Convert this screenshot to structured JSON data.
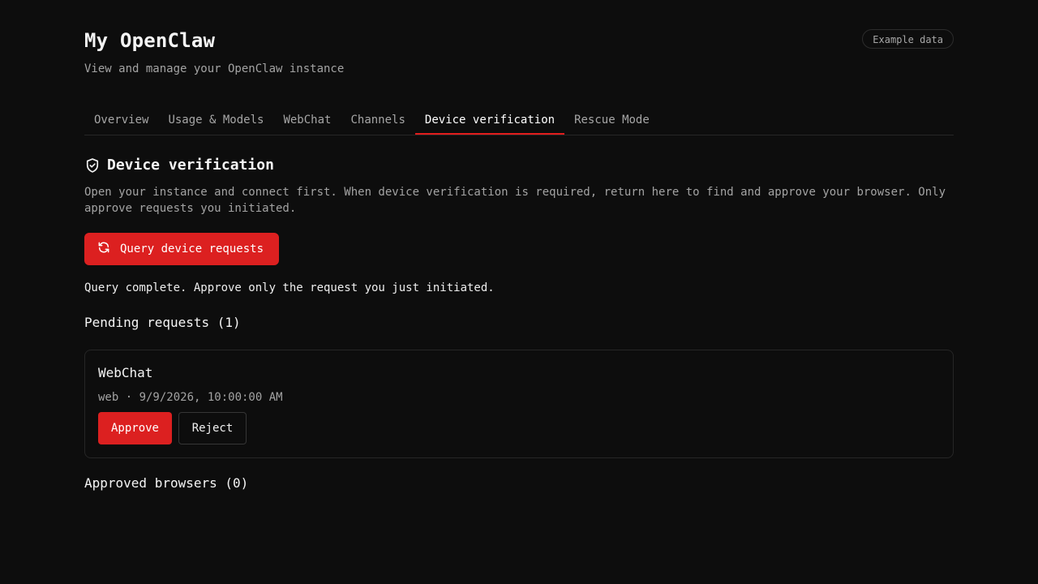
{
  "header": {
    "title": "My OpenClaw",
    "subtitle": "View and manage your OpenClaw instance",
    "badge": "Example data"
  },
  "tabs": [
    {
      "label": "Overview",
      "active": false
    },
    {
      "label": "Usage & Models",
      "active": false
    },
    {
      "label": "WebChat",
      "active": false
    },
    {
      "label": "Channels",
      "active": false
    },
    {
      "label": "Device verification",
      "active": true
    },
    {
      "label": "Rescue Mode",
      "active": false
    }
  ],
  "section": {
    "icon": "shield-check-icon",
    "title": "Device verification",
    "description": "Open your instance and connect first. When device verification is required, return here to find and approve your browser. Only approve requests you initiated."
  },
  "query": {
    "icon": "refresh-icon",
    "button_label": "Query device requests",
    "status": "Query complete. Approve only the request you just initiated."
  },
  "pending": {
    "heading": "Pending requests (1)",
    "requests": [
      {
        "name": "WebChat",
        "meta": "web · 9/9/2026, 10:00:00 AM",
        "approve_label": "Approve",
        "reject_label": "Reject"
      }
    ]
  },
  "approved": {
    "heading": "Approved browsers (0)"
  },
  "colors": {
    "background": "#0d0d0d",
    "accent": "#dc2020",
    "muted_text": "#a3a3a3",
    "border": "#262626"
  }
}
